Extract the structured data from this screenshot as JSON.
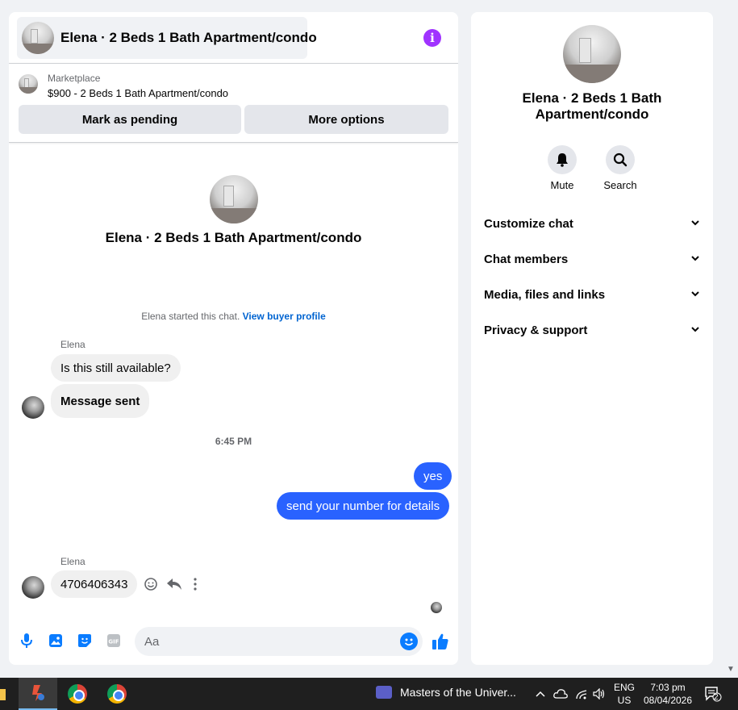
{
  "chat": {
    "title": "Elena · 2 Beds 1 Bath Apartment/condo",
    "marketplace_label": "Marketplace",
    "listing": "$900 - 2 Beds 1 Bath Apartment/condo",
    "mark_pending": "Mark as pending",
    "more_options": "More options",
    "center_title": "Elena · 2 Beds 1 Bath Apartment/condo",
    "started_text": "Elena started this chat.",
    "buyer_profile_link": "View buyer profile",
    "messages": [
      {
        "sender": "Elena",
        "text": "Is this still available?",
        "direction": "in"
      },
      {
        "text": "Message sent",
        "direction": "in"
      },
      {
        "timestamp": "6:45 PM"
      },
      {
        "text": "yes",
        "direction": "out"
      },
      {
        "text": "send your number for details",
        "direction": "out"
      },
      {
        "sender": "Elena",
        "text": "4706406343",
        "direction": "in"
      }
    ],
    "input_placeholder": "Aa"
  },
  "details": {
    "title": "Elena · 2 Beds 1 Bath Apartment/condo",
    "actions": [
      {
        "label": "Mute",
        "icon": "bell-icon"
      },
      {
        "label": "Search",
        "icon": "search-icon"
      }
    ],
    "sections": [
      "Customize chat",
      "Chat members",
      "Media, files and links",
      "Privacy & support"
    ]
  },
  "taskbar": {
    "media_title": "Masters of the Univer...",
    "lang_primary": "ENG",
    "lang_secondary": "US",
    "time": "7:03 pm",
    "date": "08/04/2026",
    "notification_count": "2"
  },
  "colors": {
    "accent_blue": "#2962ff",
    "info_purple": "#a033ff",
    "link_blue": "#0064d1"
  }
}
